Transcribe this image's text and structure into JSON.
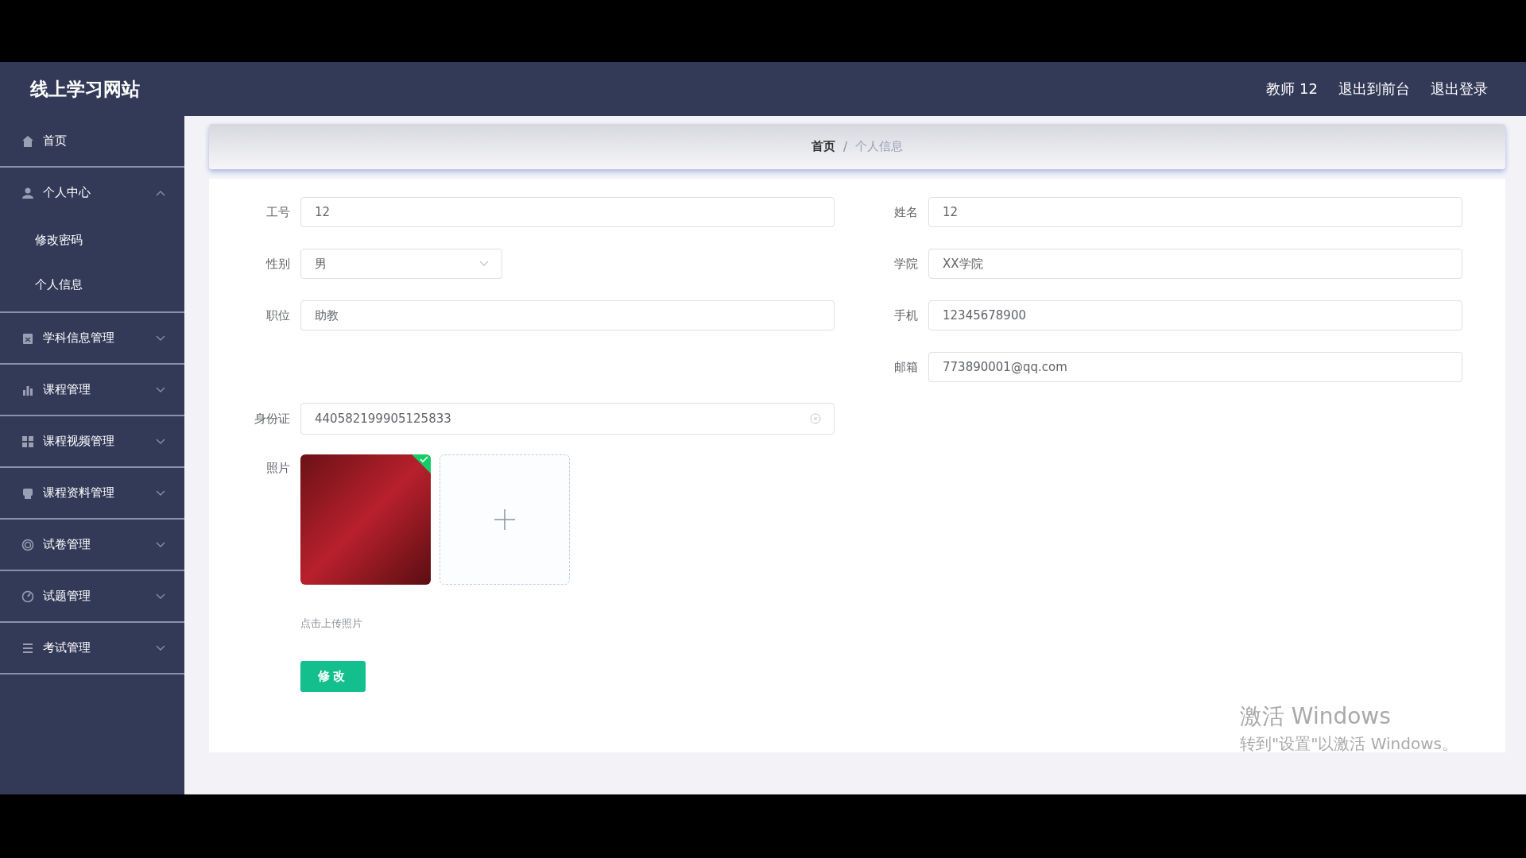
{
  "header": {
    "title": "线上学习网站",
    "user": "教师 12",
    "links": [
      "退出到前台",
      "退出登录"
    ]
  },
  "sidebar": {
    "items": [
      {
        "label": "首页",
        "kind": "link",
        "expanded": false
      },
      {
        "label": "个人中心",
        "kind": "menu",
        "expanded": true,
        "children": [
          {
            "label": "修改密码"
          },
          {
            "label": "个人信息"
          }
        ]
      },
      {
        "label": "学科信息管理",
        "kind": "menu",
        "expanded": false
      },
      {
        "label": "课程管理",
        "kind": "menu",
        "expanded": false
      },
      {
        "label": "课程视频管理",
        "kind": "menu",
        "expanded": false
      },
      {
        "label": "课程资料管理",
        "kind": "menu",
        "expanded": false
      },
      {
        "label": "试卷管理",
        "kind": "menu",
        "expanded": false
      },
      {
        "label": "试题管理",
        "kind": "menu",
        "expanded": false
      },
      {
        "label": "考试管理",
        "kind": "menu",
        "expanded": false
      }
    ]
  },
  "breadcrumb": {
    "separator": "/",
    "items": [
      {
        "label": "首页",
        "current": false
      },
      {
        "label": "个人信息",
        "current": true
      }
    ]
  },
  "form": {
    "rows": [
      {
        "left": {
          "label": "工号",
          "value": "12",
          "kind": "text"
        },
        "right": {
          "label": "姓名",
          "value": "12",
          "kind": "text"
        }
      },
      {
        "left": {
          "label": "性别",
          "value": "男",
          "kind": "select"
        },
        "right": {
          "label": "学院",
          "value": "XX学院",
          "kind": "text"
        }
      },
      {
        "left": {
          "label": "职位",
          "value": "助教",
          "kind": "text"
        },
        "right": {
          "label": "手机",
          "value": "12345678900",
          "kind": "text"
        }
      },
      {
        "right": {
          "label": "邮箱",
          "value": "773890001@qq.com",
          "kind": "text"
        }
      },
      {
        "left": {
          "label": "身份证",
          "value": "440582199905125833",
          "kind": "clearable"
        }
      }
    ],
    "photo": {
      "label": "照片",
      "uploaded": true,
      "hint": "点击上传照片"
    },
    "submit": "修改"
  },
  "os_overlay": {
    "title": "激活 Windows",
    "subtitle": "转到\"设置\"以激活 Windows。"
  }
}
